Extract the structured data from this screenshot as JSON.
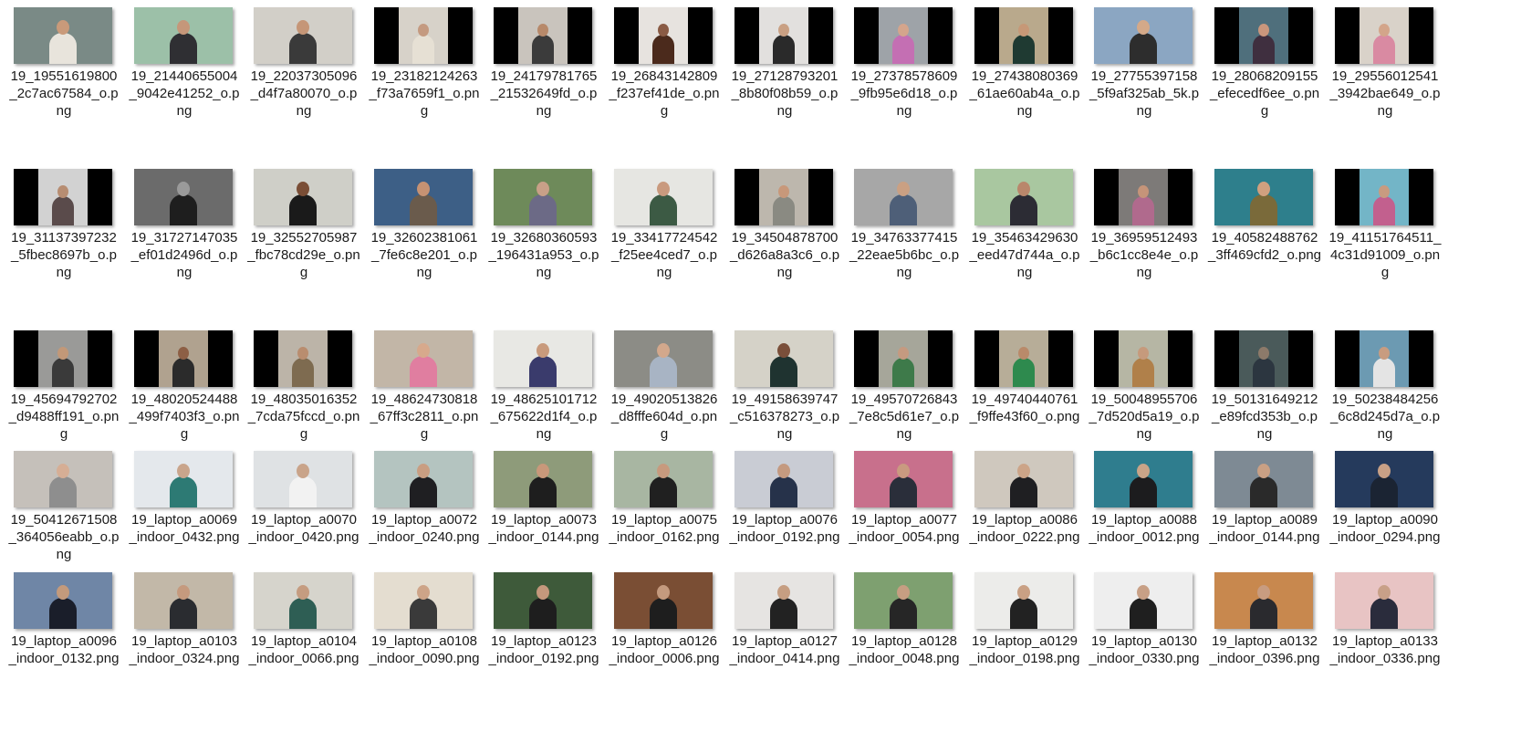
{
  "window_title": "",
  "files": [
    {
      "name": "19_19551619800_2c7ac67584_o.png",
      "layout": "full",
      "bg": "#7a8a86",
      "skin": "#c99a7a",
      "cloth": "#e8e4dc"
    },
    {
      "name": "19_21440655004_9042e41252_o.png",
      "layout": "full",
      "bg": "#9cc0a8",
      "skin": "#c5977a",
      "cloth": "#2f2f33"
    },
    {
      "name": "19_22037305096_d4f7a80070_o.png",
      "layout": "full",
      "bg": "#d2cfc8",
      "skin": "#c59677",
      "cloth": "#3a3a3a"
    },
    {
      "name": "19_23182124263_f73a7659f1_o.png",
      "layout": "letter",
      "bg": "#d7d2c9",
      "skin": "#c49a80",
      "cloth": "#e6e0d4"
    },
    {
      "name": "19_24179781765_21532649fd_o.png",
      "layout": "letter",
      "bg": "#c9c4bd",
      "skin": "#b7896a",
      "cloth": "#3b3b3b"
    },
    {
      "name": "19_26843142809_f237ef41de_o.png",
      "layout": "letter",
      "bg": "#e7e3df",
      "skin": "#8a5b45",
      "cloth": "#4b2a1c"
    },
    {
      "name": "19_27128793201_8b80f08b59_o.png",
      "layout": "letter",
      "bg": "#e2e0de",
      "skin": "#c9a083",
      "cloth": "#2a2a2a"
    },
    {
      "name": "19_27378578609_9fb95e6d18_o.png",
      "layout": "letter",
      "bg": "#9ea3a8",
      "skin": "#d4a58c",
      "cloth": "#c46fb3"
    },
    {
      "name": "19_27438080369_61ae60ab4a_o.png",
      "layout": "letter",
      "bg": "#b9a98c",
      "skin": "#c69877",
      "cloth": "#1f3a32"
    },
    {
      "name": "19_27755397158_5f9af325ab_5k.png",
      "layout": "full",
      "bg": "#8ba6c2",
      "skin": "#d4a989",
      "cloth": "#2d2d2d"
    },
    {
      "name": "19_28068209155_efecedf6ee_o.png",
      "layout": "letter",
      "bg": "#4f6f7c",
      "skin": "#c9967c",
      "cloth": "#3f2f3f"
    },
    {
      "name": "19_29556012541_3942bae649_o.png",
      "layout": "letter",
      "bg": "#d9d2c9",
      "skin": "#d3a58a",
      "cloth": "#d98aa2"
    },
    {
      "name": "19_31137397232_5fbec8697b_o.png",
      "layout": "letter",
      "bg": "#d2d2d2",
      "skin": "#b78d72",
      "cloth": "#5a4b4b"
    },
    {
      "name": "19_31727147035_ef01d2496d_o.png",
      "layout": "full",
      "bg": "#6b6b6b",
      "skin": "#9a9a9a",
      "cloth": "#1e1e1e"
    },
    {
      "name": "19_32552705987_fbc78cd29e_o.png",
      "layout": "full",
      "bg": "#cfcfc8",
      "skin": "#7a4e36",
      "cloth": "#1a1a1a"
    },
    {
      "name": "19_32602381061_7fe6c8e201_o.png",
      "layout": "full",
      "bg": "#3d5f86",
      "skin": "#c69273",
      "cloth": "#6a5b4c"
    },
    {
      "name": "19_32680360593_196431a953_o.png",
      "layout": "full",
      "bg": "#6e8a5a",
      "skin": "#c8a088",
      "cloth": "#6c6a86"
    },
    {
      "name": "19_33417724542_f25ee4ced7_o.png",
      "layout": "full",
      "bg": "#e6e6e2",
      "skin": "#c99a7e",
      "cloth": "#3c5a44"
    },
    {
      "name": "19_34504878700_d626a8a3c6_o.png",
      "layout": "letter",
      "bg": "#bdb7ad",
      "skin": "#c8987a",
      "cloth": "#8a8a82"
    },
    {
      "name": "19_34763377415_22eae5b6bc_o.png",
      "layout": "full",
      "bg": "#a7a7a7",
      "skin": "#caa083",
      "cloth": "#4e5f78"
    },
    {
      "name": "19_35463429630_eed47d744a_o.png",
      "layout": "full",
      "bg": "#a9c7a0",
      "skin": "#b9876b",
      "cloth": "#2c2c34"
    },
    {
      "name": "19_36959512493_b6c1cc8e4e_o.png",
      "layout": "letter",
      "bg": "#7d7a78",
      "skin": "#c59479",
      "cloth": "#b06a8d"
    },
    {
      "name": "19_40582488762_3ff469cfd2_o.png",
      "layout": "full",
      "bg": "#2e7f8c",
      "skin": "#d0a07f",
      "cloth": "#7a6a3a"
    },
    {
      "name": "19_41151764511_4c31d91009_o.png",
      "layout": "letter",
      "bg": "#73b5c7",
      "skin": "#c89b80",
      "cloth": "#c2608e"
    },
    {
      "name": "19_45694792702_d9488ff191_o.png",
      "layout": "letter",
      "bg": "#9a9a98",
      "skin": "#c29878",
      "cloth": "#3a3a3a"
    },
    {
      "name": "19_48020524488_499f7403f3_o.png",
      "layout": "letter",
      "bg": "#b0a28f",
      "skin": "#8d5f45",
      "cloth": "#2b2b2b"
    },
    {
      "name": "19_48035016352_7cda75fccd_o.png",
      "layout": "letter",
      "bg": "#bcb4a8",
      "skin": "#b98d6f",
      "cloth": "#7e6b50"
    },
    {
      "name": "19_48624730818_67ff3c2811_o.png",
      "layout": "full",
      "bg": "#c2b6a7",
      "skin": "#d7a98c",
      "cloth": "#e07ea0"
    },
    {
      "name": "19_48625101712_675622d1f4_o.png",
      "layout": "full",
      "bg": "#e8e8e4",
      "skin": "#c89a7c",
      "cloth": "#3a3b6c"
    },
    {
      "name": "19_49020513826_d8fffe604d_o.png",
      "layout": "full",
      "bg": "#8c8c86",
      "skin": "#d3a88c",
      "cloth": "#a8b4c4"
    },
    {
      "name": "19_49158639747_c516378273_o.png",
      "layout": "full",
      "bg": "#d5d2c8",
      "skin": "#7a4f3a",
      "cloth": "#1f3330"
    },
    {
      "name": "19_49570726843_7e8c5d61e7_o.png",
      "layout": "letter",
      "bg": "#a6a69a",
      "skin": "#c59a80",
      "cloth": "#3e7a4a"
    },
    {
      "name": "19_49740440761_f9ffe43f60_o.png",
      "layout": "letter",
      "bg": "#b7ad98",
      "skin": "#b98a6a",
      "cloth": "#2e8a4e"
    },
    {
      "name": "19_50048955706_7d520d5a19_o.png",
      "layout": "letter",
      "bg": "#b6b6a4",
      "skin": "#c69a7c",
      "cloth": "#b0804a"
    },
    {
      "name": "19_50131649212_e89fcd353b_o.png",
      "layout": "letter",
      "bg": "#4a5a5a",
      "skin": "#8c7a6a",
      "cloth": "#2c3640"
    },
    {
      "name": "19_50238484256_6c8d245d7a_o.png",
      "layout": "letter",
      "bg": "#6c9ab2",
      "skin": "#c89c80",
      "cloth": "#e4e4e4"
    },
    {
      "name": "19_50412671508_364056eabb_o.png",
      "layout": "full",
      "bg": "#c5c0ba",
      "skin": "#d6ae95",
      "cloth": "#8e8e8e"
    },
    {
      "name": "19_laptop_a0069_indoor_0432.png",
      "layout": "full",
      "bg": "#e4e8ec",
      "skin": "#c9a58c",
      "cloth": "#2d7a74"
    },
    {
      "name": "19_laptop_a0070_indoor_0420.png",
      "layout": "full",
      "bg": "#dfe2e4",
      "skin": "#c9a48a",
      "cloth": "#f2f2f2"
    },
    {
      "name": "19_laptop_a0072_indoor_0240.png",
      "layout": "full",
      "bg": "#b4c4c0",
      "skin": "#c99e82",
      "cloth": "#1f1f22"
    },
    {
      "name": "19_laptop_a0073_indoor_0144.png",
      "layout": "full",
      "bg": "#8e9b7a",
      "skin": "#c8987a",
      "cloth": "#1e1e1e"
    },
    {
      "name": "19_laptop_a0075_indoor_0162.png",
      "layout": "full",
      "bg": "#a8b6a2",
      "skin": "#c79a7e",
      "cloth": "#202020"
    },
    {
      "name": "19_laptop_a0076_indoor_0192.png",
      "layout": "full",
      "bg": "#c9ccd4",
      "skin": "#c49a80",
      "cloth": "#26324a"
    },
    {
      "name": "19_laptop_a0077_indoor_0054.png",
      "layout": "full",
      "bg": "#c8708c",
      "skin": "#c99a80",
      "cloth": "#2a2e3a"
    },
    {
      "name": "19_laptop_a0086_indoor_0222.png",
      "layout": "full",
      "bg": "#cfc8be",
      "skin": "#cca488",
      "cloth": "#1f1f22"
    },
    {
      "name": "19_laptop_a0088_indoor_0012.png",
      "layout": "full",
      "bg": "#2f7d8e",
      "skin": "#c9a488",
      "cloth": "#1c1c1e"
    },
    {
      "name": "19_laptop_a0089_indoor_0144.png",
      "layout": "full",
      "bg": "#7e8a94",
      "skin": "#c9a084",
      "cloth": "#2a2a2a"
    },
    {
      "name": "19_laptop_a0090_indoor_0294.png",
      "layout": "full",
      "bg": "#253a5c",
      "skin": "#c8a086",
      "cloth": "#1b2433"
    },
    {
      "name": "19_laptop_a0096_indoor_0132.png",
      "layout": "full",
      "bg": "#6f86a6",
      "skin": "#c39a7c",
      "cloth": "#1a1e2a"
    },
    {
      "name": "19_laptop_a0103_indoor_0324.png",
      "layout": "full",
      "bg": "#c2b8a8",
      "skin": "#c59a7e",
      "cloth": "#2a2c30"
    },
    {
      "name": "19_laptop_a0104_indoor_0066.png",
      "layout": "full",
      "bg": "#d6d4cc",
      "skin": "#c59c80",
      "cloth": "#2e5e54"
    },
    {
      "name": "19_laptop_a0108_indoor_0090.png",
      "layout": "full",
      "bg": "#e4ddd0",
      "skin": "#cda488",
      "cloth": "#3a3a3a"
    },
    {
      "name": "19_laptop_a0123_indoor_0192.png",
      "layout": "full",
      "bg": "#3e5a3a",
      "skin": "#c4987c",
      "cloth": "#1e1e1e"
    },
    {
      "name": "19_laptop_a0126_indoor_0006.png",
      "layout": "full",
      "bg": "#7a4e34",
      "skin": "#c49a7e",
      "cloth": "#1e1e1e"
    },
    {
      "name": "19_laptop_a0127_indoor_0414.png",
      "layout": "full",
      "bg": "#e6e4e2",
      "skin": "#c69e82",
      "cloth": "#222222"
    },
    {
      "name": "19_laptop_a0128_indoor_0048.png",
      "layout": "full",
      "bg": "#7ea070",
      "skin": "#c69e82",
      "cloth": "#262626"
    },
    {
      "name": "19_laptop_a0129_indoor_0198.png",
      "layout": "full",
      "bg": "#ececea",
      "skin": "#c9a084",
      "cloth": "#222222"
    },
    {
      "name": "19_laptop_a0130_indoor_0330.png",
      "layout": "full",
      "bg": "#eeeeee",
      "skin": "#c8a086",
      "cloth": "#1f1f1f"
    },
    {
      "name": "19_laptop_a0132_indoor_0396.png",
      "layout": "full",
      "bg": "#c8884e",
      "skin": "#c89c80",
      "cloth": "#2a2a2e"
    },
    {
      "name": "19_laptop_a0133_indoor_0336.png",
      "layout": "full",
      "bg": "#e8c4c4",
      "skin": "#c8a088",
      "cloth": "#2a2c3c"
    }
  ]
}
